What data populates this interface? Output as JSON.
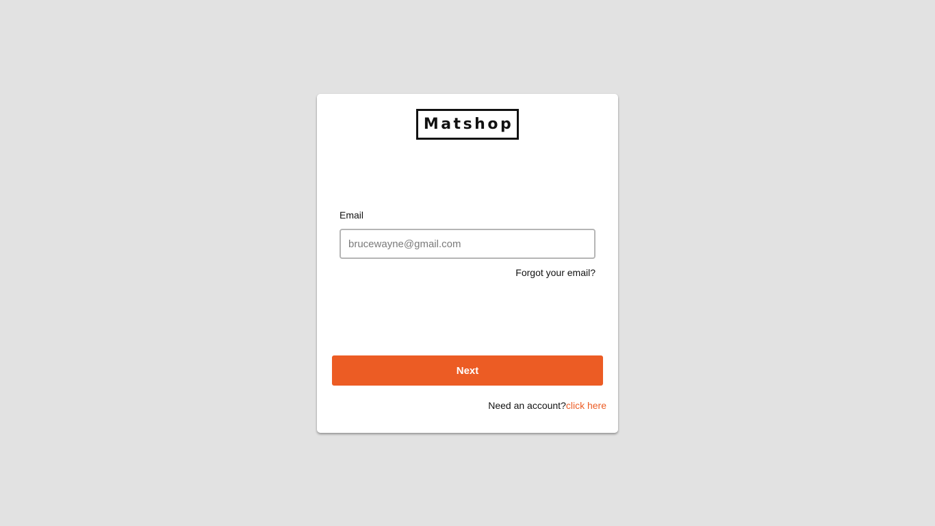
{
  "brand": {
    "logo_text": "Matshop"
  },
  "form": {
    "email_label": "Email",
    "email_value": "",
    "email_placeholder": "brucewayne@gmail.com",
    "forgot_link": "Forgot your email?",
    "next_label": "Next"
  },
  "signup": {
    "prompt": "Need an account?",
    "link": "click here"
  },
  "colors": {
    "background": "#e2e2e2",
    "accent": "#ec5c24",
    "card": "#ffffff"
  }
}
